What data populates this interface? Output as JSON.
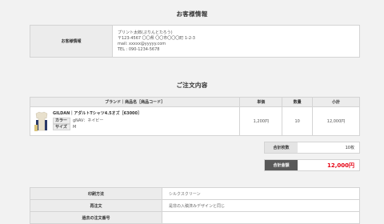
{
  "customer": {
    "title": "お客様情報",
    "label": "お客様情報",
    "lines": [
      "プリント太郎(ぷりんとたろう)",
      "〒123-4567 〇〇県 〇〇市〇〇〇町 1-2-3",
      "mail: xxxxx@yyyyy.com",
      "TEL : 090-1234-5678"
    ]
  },
  "order": {
    "title": "ご注文内容",
    "headers": {
      "product": "ブランド｜商品名［商品コード］",
      "unit_price": "単価",
      "quantity": "数量",
      "subtotal": "小計"
    },
    "item": {
      "name": "GILDAN｜アダルトTシャツ4.5オズ［63000］",
      "attributes": [
        {
          "key": "カラー",
          "value": "gNAV：ネイビー"
        },
        {
          "key": "サイズ",
          "value": "M"
        }
      ],
      "unit_price": "1,200円",
      "quantity": "10",
      "subtotal": "12,000円",
      "thumb_icon": "tshirt-icon"
    }
  },
  "summary": {
    "total_qty_label": "合計枚数",
    "total_qty_value": "10枚",
    "total_amount_label": "合計金額",
    "total_amount_value": "12,000円"
  },
  "details": [
    {
      "label": "印刷方法",
      "value": "シルクスクリーン"
    },
    {
      "label": "再注文",
      "value": "是非の入稿済みデザインと同じ"
    },
    {
      "label": "過去の注文番号",
      "value": ""
    }
  ],
  "colors": {
    "accent_red": "#e60012",
    "header_gray": "#ececec",
    "dark_label": "#595959"
  }
}
